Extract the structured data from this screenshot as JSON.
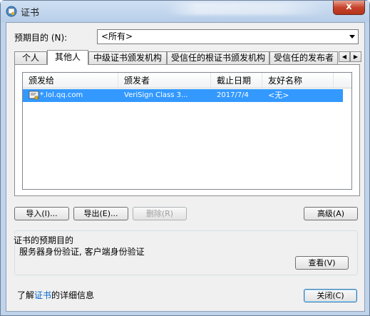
{
  "window": {
    "title": "证书",
    "close_label": "x"
  },
  "purpose": {
    "label": "预期目的 (N):",
    "selected": "<所有>"
  },
  "tabs": [
    {
      "label": "个人"
    },
    {
      "label": "其他人"
    },
    {
      "label": "中级证书颁发机构"
    },
    {
      "label": "受信任的根证书颁发机构"
    },
    {
      "label": "受信任的发布者"
    }
  ],
  "list": {
    "columns": [
      "颁发给",
      "颁发者",
      "截止日期",
      "友好名称"
    ],
    "rows": [
      {
        "issued_to": "*.lol.qq.com",
        "issued_by": "VeriSign Class 3...",
        "expiry": "2017/7/4",
        "friendly_name": "<无>"
      }
    ]
  },
  "buttons": {
    "import": "导入(I)...",
    "export": "导出(E)...",
    "delete": "删除(R)",
    "advanced": "高级(A)",
    "view": "查看(V)",
    "close": "关闭(C)"
  },
  "purposes_group": {
    "title": "证书的预期目的",
    "text": "服务器身份验证, 客户端身份验证"
  },
  "footer": {
    "prefix": "了解",
    "link": "证书",
    "suffix": "的详细信息"
  },
  "colors": {
    "selection": "#3399ff",
    "link": "#0066cc",
    "close_button": "#c7432b"
  }
}
